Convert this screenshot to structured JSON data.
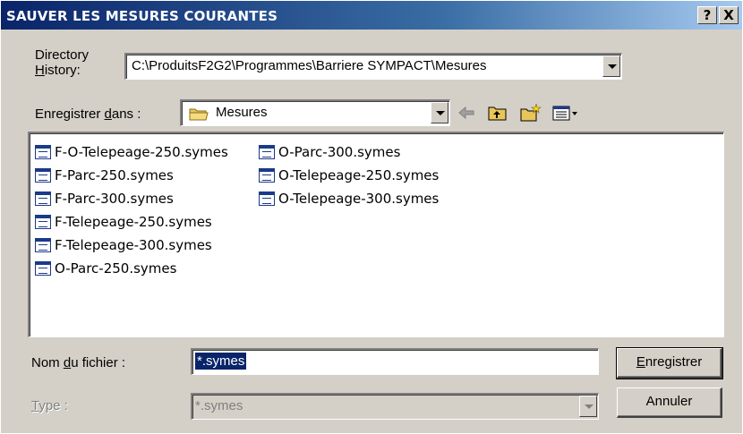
{
  "window": {
    "title": "SAUVER LES MESURES COURANTES",
    "help_glyph": "?",
    "close_glyph": "X"
  },
  "directory_history": {
    "label_line1": "Directory",
    "label_line2_ul": "H",
    "label_line2_rest": "istory:",
    "value": "C:\\ProduitsF2G2\\Programmes\\Barriere SYMPACT\\Mesures"
  },
  "save_in": {
    "label_pre": "Enregistrer ",
    "label_ul": "d",
    "label_post": "ans :",
    "value": "Mesures",
    "folder_icon": "folder-icon"
  },
  "toolbar": {
    "back_icon": "back-arrow-icon",
    "up_icon": "up-folder-icon",
    "new_folder_icon": "new-folder-icon",
    "view_icon": "view-menu-icon"
  },
  "files": {
    "column1": [
      "F-O-Telepeage-250.symes",
      "F-Parc-250.symes",
      "F-Parc-300.symes",
      "F-Telepeage-250.symes",
      "F-Telepeage-300.symes",
      "O-Parc-250.symes"
    ],
    "column2": [
      "O-Parc-300.symes",
      "O-Telepeage-250.symes",
      "O-Telepeage-300.symes"
    ]
  },
  "filename": {
    "label_pre": "Nom ",
    "label_ul": "d",
    "label_post": "u fichier :",
    "value": "*.symes"
  },
  "type": {
    "label_ul": "T",
    "label_post": "ype :",
    "value": "*.symes"
  },
  "buttons": {
    "save_ul": "E",
    "save_rest": "nregistrer",
    "cancel": "Annuler"
  },
  "colors": {
    "title_start": "#0a246a",
    "title_end": "#a6caf0",
    "face": "#d4d0c8",
    "selection": "#0a246a"
  }
}
